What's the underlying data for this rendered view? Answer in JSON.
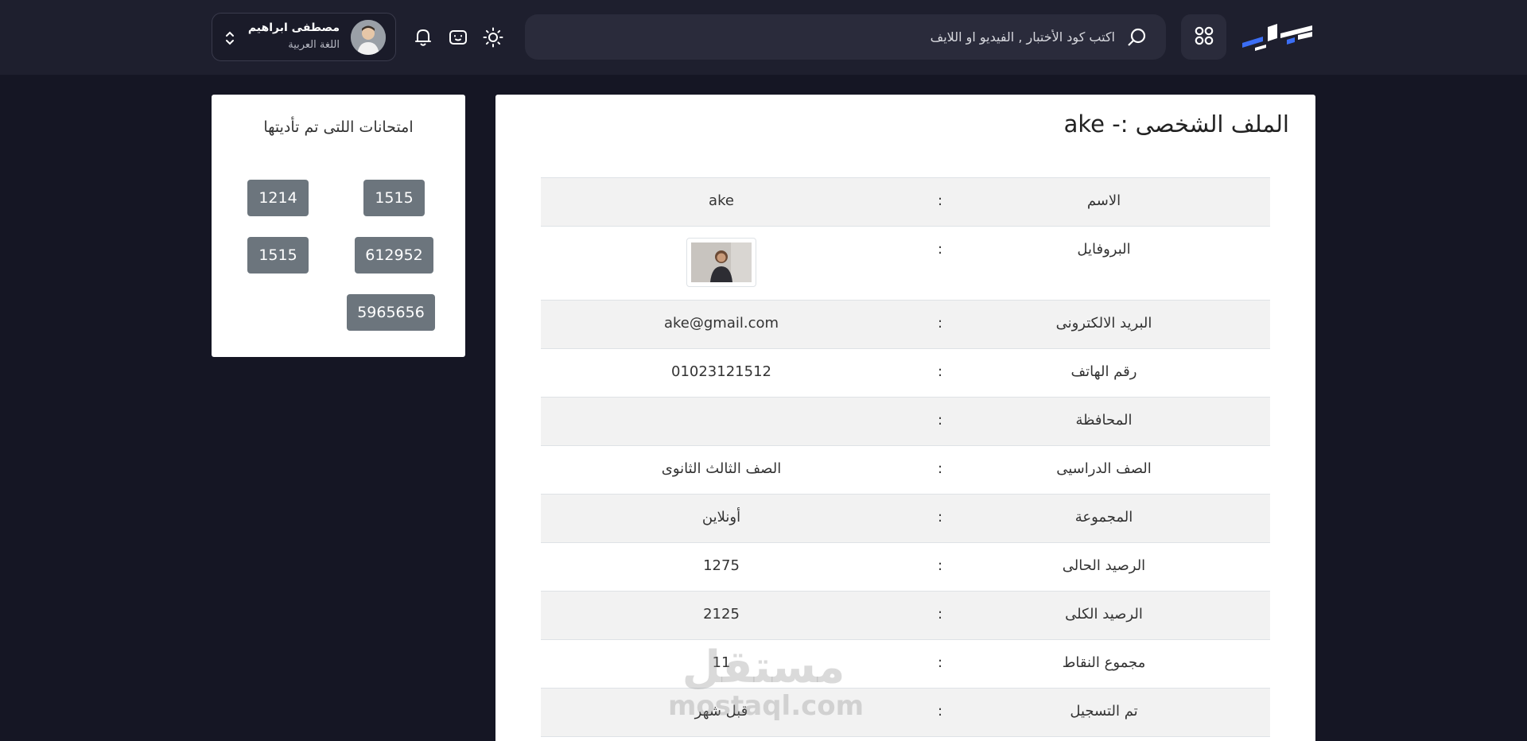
{
  "header": {
    "search_placeholder": "اكتب كود الأختبار , الفيديو او اللايف",
    "user": {
      "name": "مصطفى ابراهيم",
      "subject": "اللغة العربية"
    },
    "icons": {
      "logo": "brand-logo",
      "apps": "apps-grid-icon",
      "search": "search-icon",
      "theme": "sun-icon",
      "chat": "chat-icon",
      "notifications": "bell-icon",
      "user_menu": "chevron-up-down-icon"
    }
  },
  "exams": {
    "title": "امتحانات اللتى تم تأديتها",
    "codes": [
      "1515",
      "1214",
      "612952",
      "1515",
      "5965656"
    ]
  },
  "profile": {
    "title": "الملف الشخصى :- ake",
    "rows": [
      {
        "label": "الاسم",
        "colon": ":",
        "value": "ake"
      },
      {
        "label": "البروفايل",
        "colon": ":",
        "value": ""
      },
      {
        "label": "البريد الالكترونى",
        "colon": ":",
        "value": "ake@gmail.com"
      },
      {
        "label": "رقم الهاتف",
        "colon": ":",
        "value": "01023121512"
      },
      {
        "label": "المحافظة",
        "colon": ":",
        "value": ""
      },
      {
        "label": "الصف الدراسيى",
        "colon": ":",
        "value": "الصف الثالث الثانوى"
      },
      {
        "label": "المجموعة",
        "colon": ":",
        "value": "أونلاين"
      },
      {
        "label": "الرصيد الحالى",
        "colon": ":",
        "value": "1275"
      },
      {
        "label": "الرصيد الكلى",
        "colon": ":",
        "value": "2125"
      },
      {
        "label": "مجموع النقاط",
        "colon": ":",
        "value": "11"
      },
      {
        "label": "تم التسجيل",
        "colon": ":",
        "value": "قبل شهر"
      }
    ]
  },
  "watermark": {
    "arabic": "مستقل",
    "latin": "mostaql.com"
  },
  "colors": {
    "background": "#151624",
    "header": "#1e1f2e",
    "accent_blue": "#3b6ef5",
    "exam_button": "#6c757d"
  }
}
